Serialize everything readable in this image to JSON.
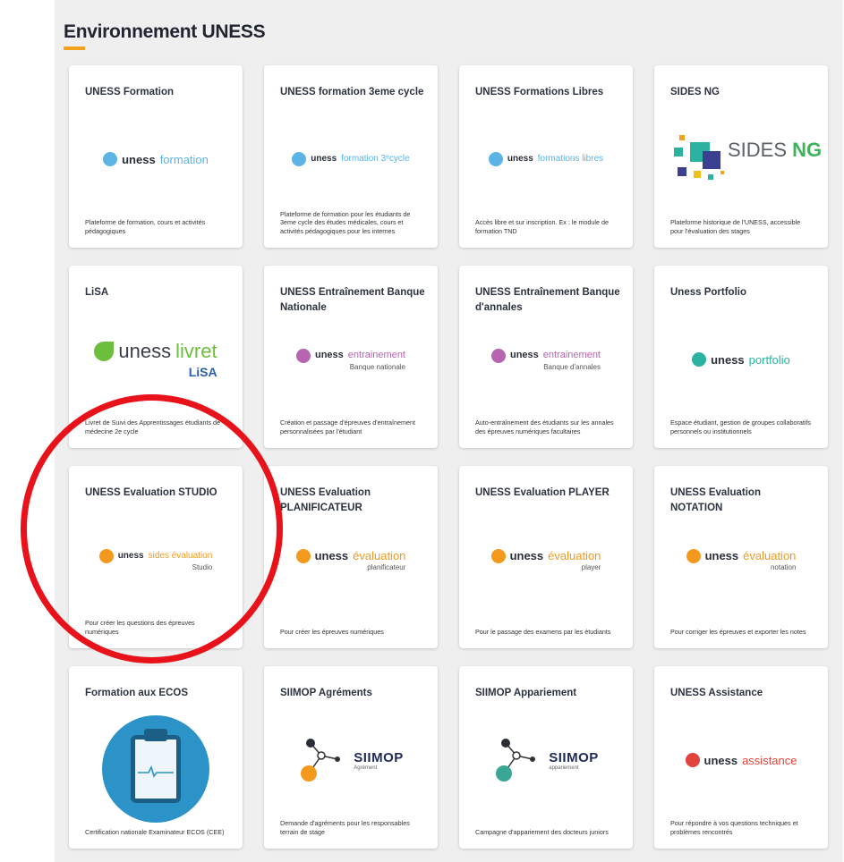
{
  "section": {
    "title": "Environnement UNESS",
    "accent": "#f2a21b"
  },
  "cards": [
    {
      "title": "UNESS Formation",
      "logo": {
        "word_a": "uness",
        "word_b": "formation",
        "sub": "",
        "icon": "uness-drop-icon",
        "color": "#5bb3e6"
      },
      "desc": "Plateforme de formation, cours et activités pédagogiques"
    },
    {
      "title": "UNESS formation 3eme cycle",
      "logo": {
        "word_a": "uness",
        "word_b": "formation 3ᵉcycle",
        "sub": "",
        "icon": "uness-drop-icon",
        "color": "#5bb3e6"
      },
      "desc": "Plateforme de formation pour les étudiants de 3eme cycle des études médicales, cours et activités pédagogiques pour les internes"
    },
    {
      "title": "UNESS Formations Libres",
      "logo": {
        "word_a": "uness",
        "word_b": "formations libres",
        "sub": "",
        "icon": "uness-drop-icon",
        "color": "#5bb3e6"
      },
      "desc": "Accès libre et sur inscription. Ex : le module de formation TND"
    },
    {
      "title": "SIDES NG",
      "logo": {
        "word_a": "SIDES",
        "word_b": "NG",
        "sub": "",
        "icon": "sides-squares-icon",
        "color": "#3db25a"
      },
      "desc": "Plateforme historique de l'UNESS, accessible pour l'évaluation des stages"
    },
    {
      "title": "LiSA",
      "logo": {
        "word_a": "uness",
        "word_b": "livret",
        "sub": "LiSA",
        "icon": "leaf-icon",
        "color": "#6cbf3c"
      },
      "desc": "Livret de Suivi des Apprentissages étudiants de médecine 2e cycle"
    },
    {
      "title": "UNESS Entraînement Banque Nationale",
      "logo": {
        "word_a": "uness",
        "word_b": "entrainement",
        "sub": "Banque nationale",
        "icon": "uness-drop-icon",
        "color": "#b765b0"
      },
      "desc": "Création et passage d'épreuves d'entraînement personnalisées par l'étudiant"
    },
    {
      "title": "UNESS Entraînement Banque d'annales",
      "logo": {
        "word_a": "uness",
        "word_b": "entrainement",
        "sub": "Banque d'annales",
        "icon": "uness-drop-icon",
        "color": "#b765b0"
      },
      "desc": "Auto-entraînement des étudiants sur les annales des épreuves numériques facultaires"
    },
    {
      "title": "Uness Portfolio",
      "logo": {
        "word_a": "uness",
        "word_b": "portfolio",
        "sub": "",
        "icon": "uness-drop-icon",
        "color": "#2ab3a3"
      },
      "desc": "Espace étudiant, gestion de groupes collaboratifs personnels ou institutionnels"
    },
    {
      "title": "UNESS Evaluation STUDIO",
      "logo": {
        "word_a": "uness",
        "word_b": "sides évaluation",
        "sub": "Studio",
        "icon": "uness-drop-icon",
        "color": "#f39a1e"
      },
      "desc": "Pour créer les questions des épreuves numériques"
    },
    {
      "title": "UNESS Evaluation PLANIFICATEUR",
      "logo": {
        "word_a": "uness",
        "word_b": "évaluation",
        "sub": "planificateur",
        "icon": "uness-drop-icon",
        "color": "#f39a1e"
      },
      "desc": "Pour créer les épreuves numériques"
    },
    {
      "title": "UNESS Evaluation PLAYER",
      "logo": {
        "word_a": "uness",
        "word_b": "évaluation",
        "sub": "player",
        "icon": "uness-drop-icon",
        "color": "#f39a1e"
      },
      "desc": "Pour le passage des examens par les étudiants"
    },
    {
      "title": "UNESS Evaluation NOTATION",
      "logo": {
        "word_a": "uness",
        "word_b": "évaluation",
        "sub": "notation",
        "icon": "uness-drop-icon",
        "color": "#f39a1e"
      },
      "desc": "Pour corriger les épreuves et exporter les notes"
    },
    {
      "title": "Formation aux ECOS",
      "logo": {
        "word_a": "",
        "word_b": "",
        "sub": "",
        "icon": "clipboard-pulse-icon",
        "color": "#2b93c8"
      },
      "desc": "Certification nationale Examinateur ECOS (CEE)"
    },
    {
      "title": "SIIMOP Agréments",
      "logo": {
        "word_a": "SIIMOP",
        "word_b": "",
        "sub": "Agrément",
        "icon": "network-nodes-icon",
        "color": "#f39a1e"
      },
      "desc": "Demande d'agréments pour les responsables terrain de stage"
    },
    {
      "title": "SIIMOP Appariement",
      "logo": {
        "word_a": "SIIMOP",
        "word_b": "",
        "sub": "appariement",
        "icon": "network-nodes-icon",
        "color": "#3aa796"
      },
      "desc": "Campagne d'appariement des docteurs juniors"
    },
    {
      "title": "UNESS Assistance",
      "logo": {
        "word_a": "uness",
        "word_b": "assistance",
        "sub": "",
        "icon": "uness-drop-icon",
        "color": "#e2433d"
      },
      "desc": "Pour répondre à vos questions techniques et problèmes rencontrés"
    }
  ],
  "annotation": {
    "color": "#e8121a",
    "target": "UNESS Evaluation STUDIO"
  }
}
